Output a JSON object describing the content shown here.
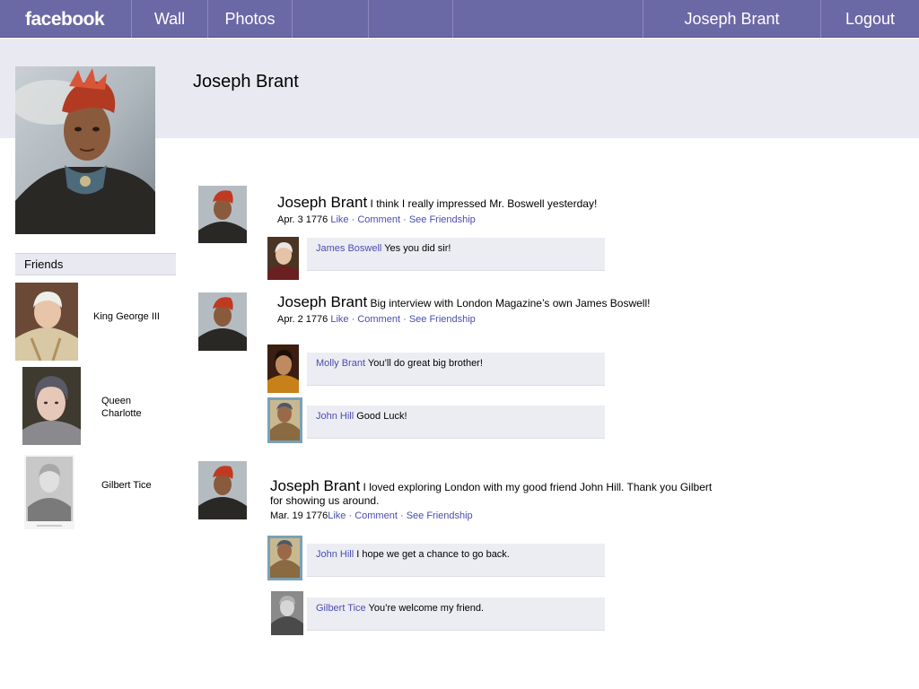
{
  "nav": {
    "logo": "facebook",
    "wall": "Wall",
    "photos": "Photos",
    "user": "Joseph Brant",
    "logout": "Logout"
  },
  "profile": {
    "name": "Joseph Brant"
  },
  "friends": {
    "header": "Friends",
    "items": [
      {
        "name": "King George III"
      },
      {
        "name": "Queen Charlotte"
      },
      {
        "name": "Gilbert Tice"
      }
    ]
  },
  "posts": [
    {
      "author": "Joseph Brant",
      "text": "I think I really impressed Mr. Boswell yesterday!",
      "date": "Apr. 3 1776",
      "actions": {
        "like": "Like",
        "comment": "Comment",
        "friendship": "See Friendship",
        "sep": "·"
      },
      "comments": [
        {
          "author": "James Boswell",
          "text": "Yes you did sir!"
        }
      ]
    },
    {
      "author": "Joseph Brant",
      "text": "Big interview with London Magazine’s own James Boswell!",
      "date": "Apr. 2 1776",
      "actions": {
        "like": "Like",
        "comment": "Comment",
        "friendship": "See Friendship",
        "sep": "·"
      },
      "comments": [
        {
          "author": "Molly Brant",
          "text": "You’ll do great big brother!"
        },
        {
          "author": "John Hill",
          "text": "Good Luck!"
        }
      ]
    },
    {
      "author": "Joseph Brant",
      "text": "I loved exploring London with my good friend John Hill.  Thank you Gilbert for showing us around.",
      "date": "Mar. 19 1776",
      "actions": {
        "like": "Like",
        "comment": "Comment",
        "friendship": "See Friendship",
        "sep": "·"
      },
      "comments": [
        {
          "author": "John Hill",
          "text": "I hope we get a chance to go back."
        },
        {
          "author": "Gilbert Tice",
          "text": "You’re welcome my friend."
        }
      ]
    }
  ]
}
